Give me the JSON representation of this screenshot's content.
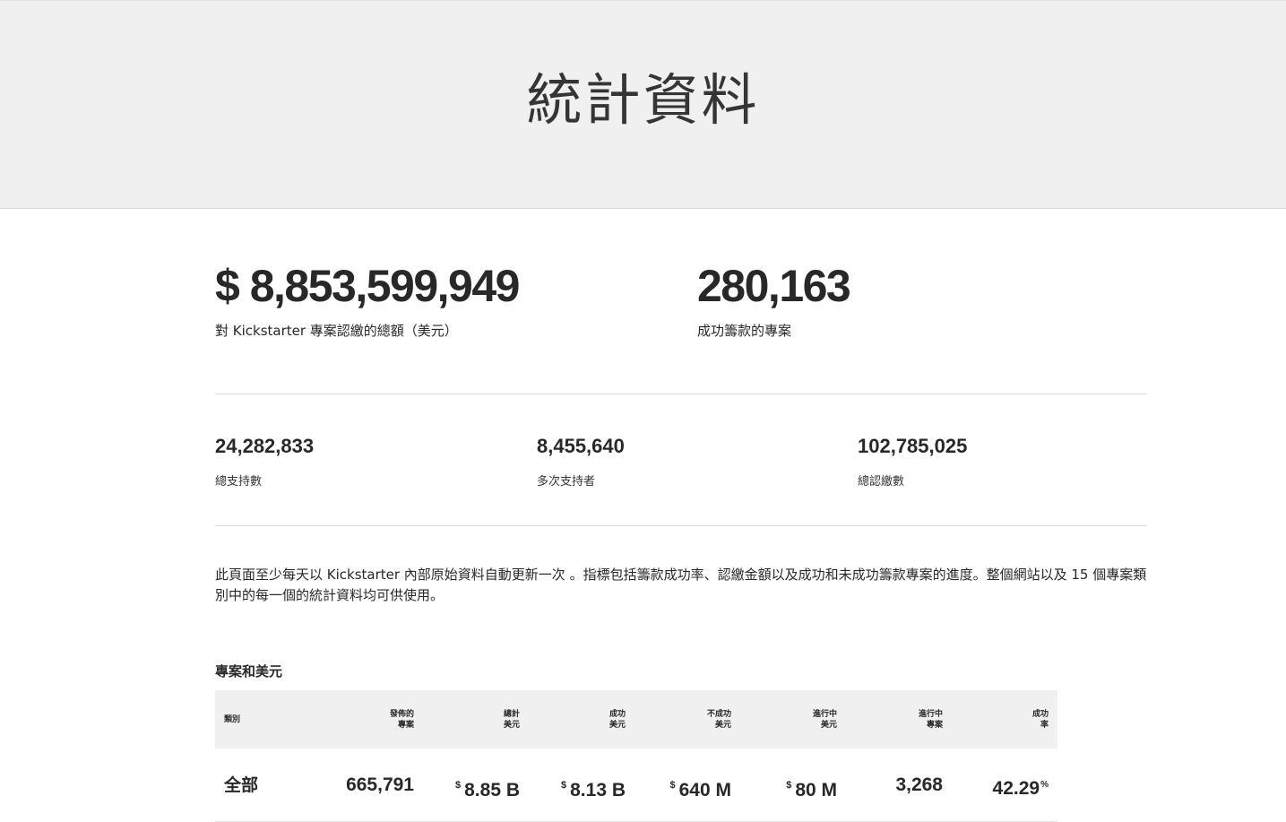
{
  "hero": {
    "title": "統計資料"
  },
  "headline_stats": [
    {
      "value": "$ 8,853,599,949",
      "label": "對 Kickstarter 專案認繳的總額（美元）"
    },
    {
      "value": "280,163",
      "label": "成功籌款的專案"
    }
  ],
  "secondary_stats": [
    {
      "value": "24,282,833",
      "label": "總支持數"
    },
    {
      "value": "8,455,640",
      "label": "多次支持者"
    },
    {
      "value": "102,785,025",
      "label": "總認繳數"
    }
  ],
  "description": "此頁面至少每天以 Kickstarter 內部原始資料自動更新一次 。指標包括籌款成功率、認繳金額以及成功和未成功籌款專案的進度。整個網站以及 15 個專案類別中的每一個的統計資料均可供使用。",
  "projects_table": {
    "title": "專案和美元",
    "headers": [
      "類別",
      "發佈的\n專案",
      "總計\n美元",
      "成功\n美元",
      "不成功\n美元",
      "進行中\n美元",
      "進行中\n專案",
      "成功\n率"
    ],
    "rows": [
      {
        "category": "全部",
        "launched": "665,791",
        "total_currency": "$",
        "total": "8.85 B",
        "successful_currency": "$",
        "successful": "8.13 B",
        "unsuccessful_currency": "$",
        "unsuccessful": "640 M",
        "live_currency": "$",
        "live": "80 M",
        "live_projects": "3,268",
        "success_rate": "42.29",
        "success_rate_unit": "%"
      }
    ]
  }
}
